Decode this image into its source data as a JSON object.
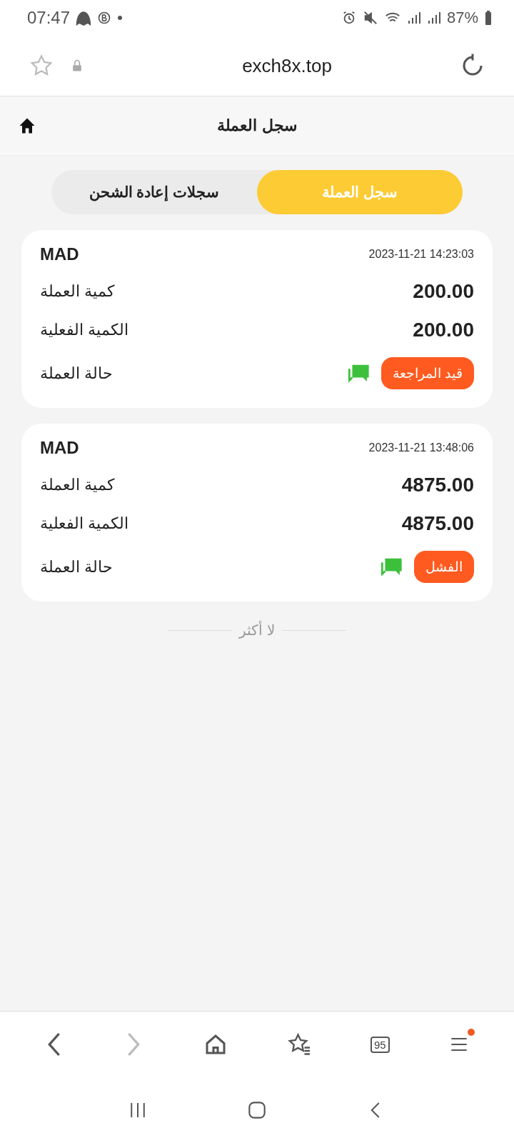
{
  "status_bar": {
    "time": "07:47",
    "battery": "87%"
  },
  "browser": {
    "url": "exch8x.top"
  },
  "header": {
    "title": "سجل العملة"
  },
  "tabs": [
    {
      "label": "سجل العملة",
      "selected": true
    },
    {
      "label": "سجلات إعادة الشحن",
      "selected": false
    }
  ],
  "records": [
    {
      "currency": "MAD",
      "time": "2023-11-21 14:23:03",
      "amount_label": "كمية العملة",
      "amount": "200.00",
      "actual_label": "الكمية الفعلية",
      "actual": "200.00",
      "status_label": "حالة العملة",
      "status": "قيد المراجعة"
    },
    {
      "currency": "MAD",
      "time": "2023-11-21 13:48:06",
      "amount_label": "كمية العملة",
      "amount": "4875.00",
      "actual_label": "الكمية الفعلية",
      "actual": "4875.00",
      "status_label": "حالة العملة",
      "status": "الفشل"
    }
  ],
  "end_text": "لا أكثر",
  "bottom_bar": {
    "tab_count": "95",
    "menu_badge": true
  }
}
